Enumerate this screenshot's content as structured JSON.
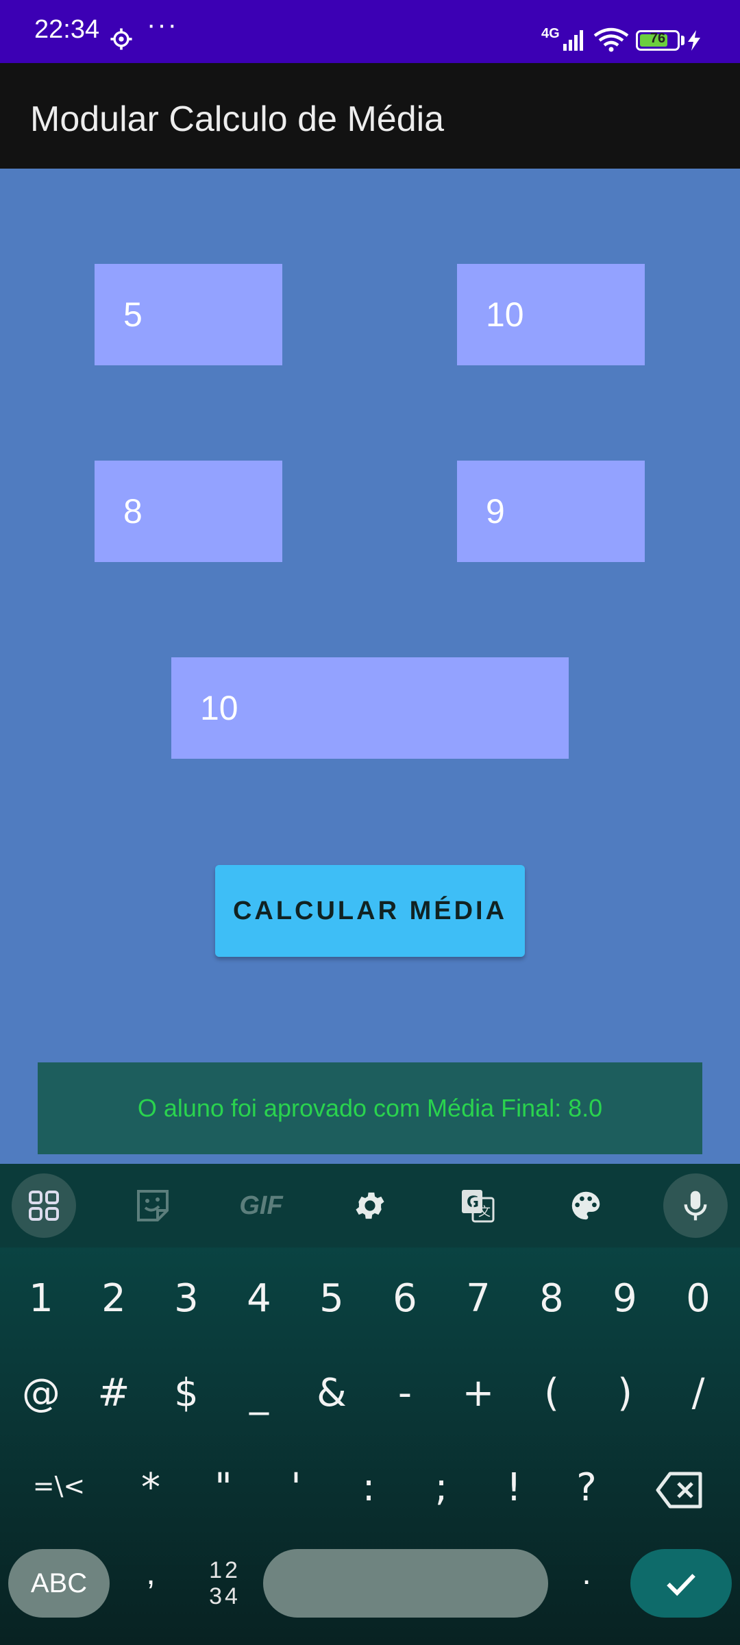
{
  "status_bar": {
    "time": "22:34",
    "more": "···",
    "network": "4G",
    "battery": "76",
    "battery_level_percent": 76
  },
  "app_bar": {
    "title": "Modular Calculo de Média"
  },
  "grades": {
    "n1": "5",
    "n2": "10",
    "n3": "8",
    "n4": "9",
    "n5": "10"
  },
  "button": {
    "label": "CALCULAR MÉDIA"
  },
  "result": {
    "text": "O aluno foi aprovado com Média Final: 8.0"
  },
  "keyboard": {
    "toolbar_icons": [
      "apps-grid-icon",
      "sticker-icon",
      "gif-icon",
      "settings-icon",
      "translate-icon",
      "palette-icon",
      "microphone-icon"
    ],
    "gif_label": "GIF",
    "row1": [
      "1",
      "2",
      "3",
      "4",
      "5",
      "6",
      "7",
      "8",
      "9",
      "0"
    ],
    "row2": [
      "@",
      "#",
      "$",
      "_",
      "&",
      "-",
      "+",
      "(",
      ")",
      "/"
    ],
    "row3": [
      "=\\<",
      "*",
      "\"",
      "'",
      ":",
      ";",
      "!",
      "?"
    ],
    "abc": "ABC",
    "comma": ",",
    "numbers_top": "12",
    "numbers_bottom": "34",
    "period": "."
  },
  "colors": {
    "status_bar": "#3C00B4",
    "app_bar": "#121212",
    "background": "#507CC0",
    "field": "#93A2FF",
    "button": "#3EBEF6",
    "result_bg": "#1D5E5D",
    "result_text": "#2AD34E"
  }
}
